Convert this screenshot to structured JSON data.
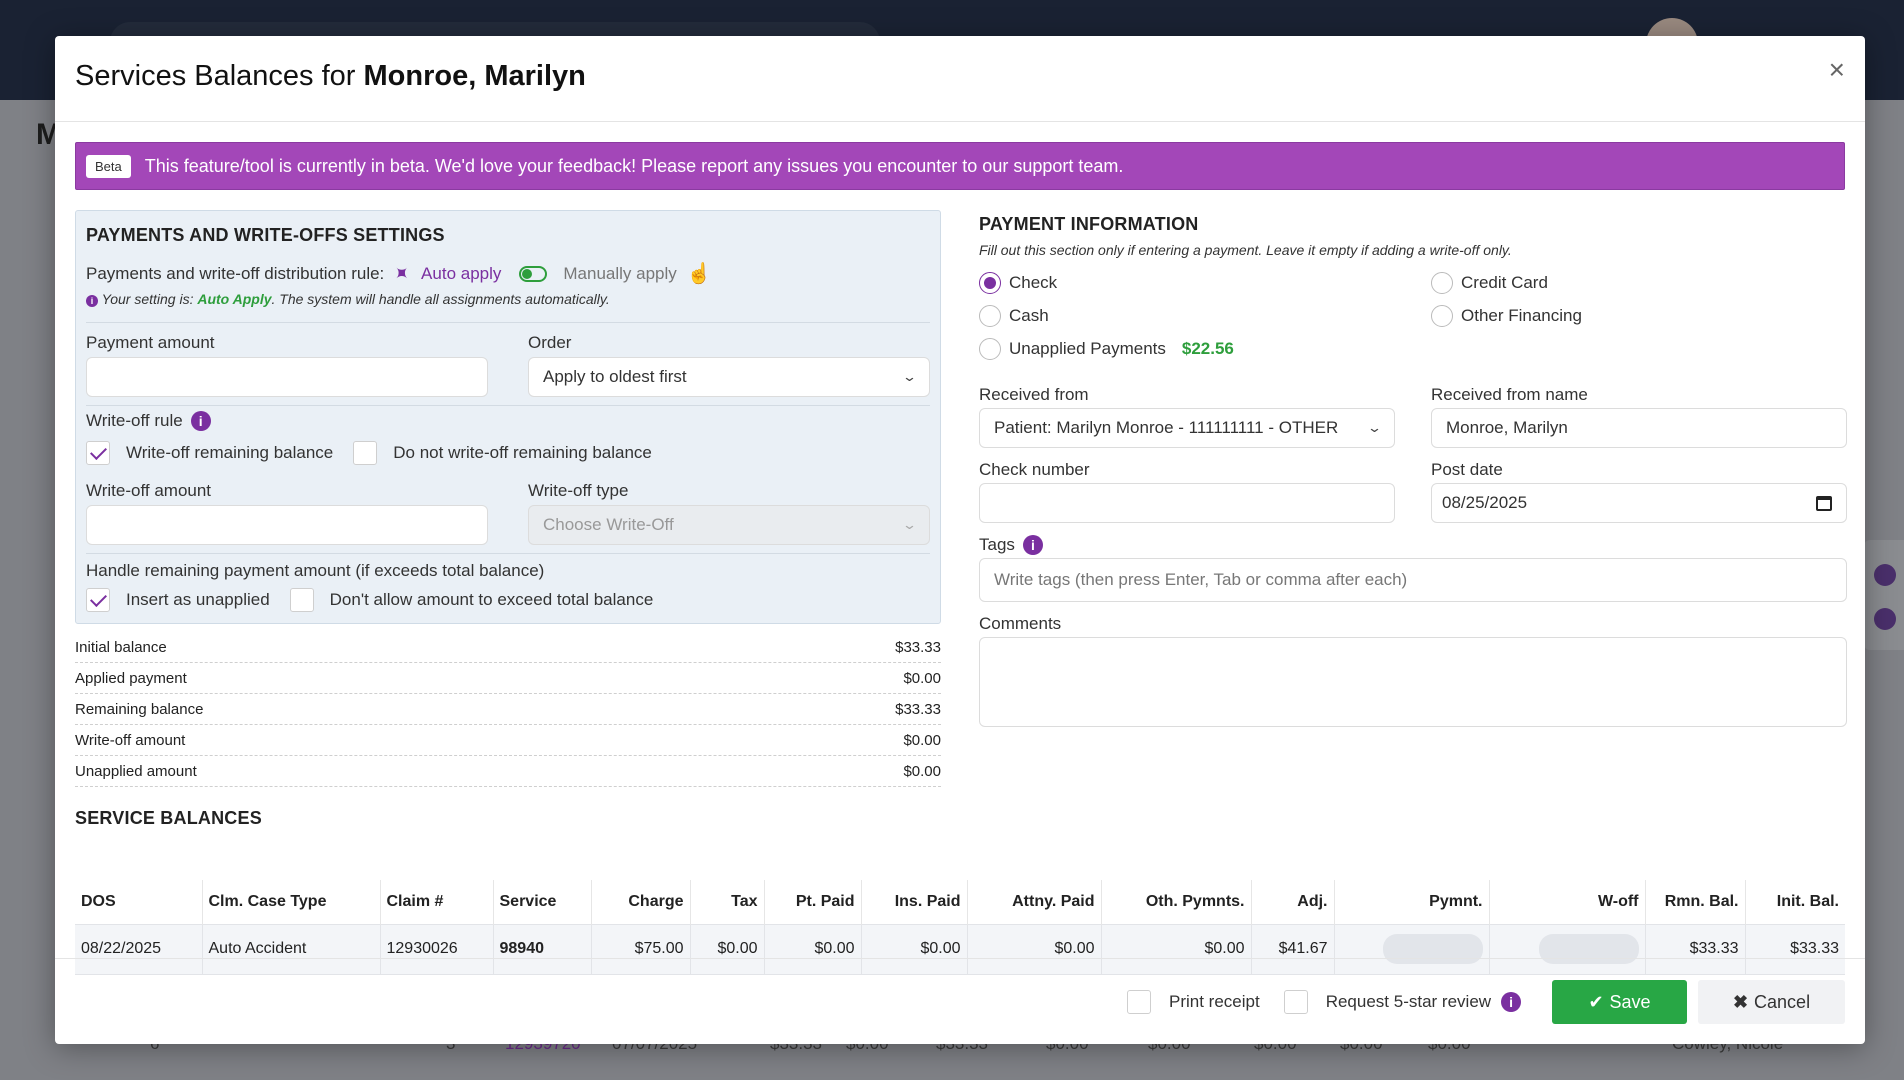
{
  "modal": {
    "title_prefix": "Services Balances for ",
    "patient_name": "Monroe, Marilyn",
    "close_glyph": "×"
  },
  "beta": {
    "badge": "Beta",
    "message": "This feature/tool is currently in beta. We'd love your feedback! Please report any issues you encounter to our support team."
  },
  "settings": {
    "title": "PAYMENTS AND WRITE-OFFS SETTINGS",
    "distribution_label": "Payments and write-off distribution rule:",
    "auto_apply": "Auto apply",
    "manually_apply": "Manually apply",
    "note_prefix": "Your setting is: ",
    "note_value": "Auto Apply",
    "note_suffix": ". The system will handle all assignments automatically.",
    "payment_amount_label": "Payment amount",
    "payment_amount_value": "",
    "order_label": "Order",
    "order_value": "Apply to oldest first",
    "writeoff_rule_label": "Write-off rule",
    "writeoff_remaining": "Write-off remaining balance",
    "no_writeoff_remaining": "Do not write-off remaining balance",
    "writeoff_amount_label": "Write-off amount",
    "writeoff_amount_value": "",
    "writeoff_type_label": "Write-off type",
    "writeoff_type_value": "Choose Write-Off",
    "handle_remaining_label": "Handle remaining payment amount (if exceeds total balance)",
    "insert_unapplied": "Insert as unapplied",
    "dont_exceed": "Don't allow amount to exceed total balance"
  },
  "summary": [
    {
      "label": "Initial balance",
      "value": "$33.33"
    },
    {
      "label": "Applied payment",
      "value": "$0.00"
    },
    {
      "label": "Remaining balance",
      "value": "$33.33"
    },
    {
      "label": "Write-off amount",
      "value": "$0.00"
    },
    {
      "label": "Unapplied amount",
      "value": "$0.00"
    }
  ],
  "payment": {
    "title": "PAYMENT INFORMATION",
    "subtitle": "Fill out this section only if entering a payment. Leave it empty if adding a write-off only.",
    "methods": {
      "check": "Check",
      "cash": "Cash",
      "unapplied": "Unapplied Payments",
      "unapplied_amount": "$22.56",
      "credit_card": "Credit Card",
      "other_financing": "Other Financing"
    },
    "received_from_label": "Received from",
    "received_from_value": "Patient: Marilyn Monroe - 111111111 - OTHER",
    "received_from_name_label": "Received from name",
    "received_from_name_value": "Monroe, Marilyn",
    "check_number_label": "Check number",
    "check_number_value": "",
    "post_date_label": "Post date",
    "post_date_value": "08/25/2025",
    "tags_label": "Tags",
    "tags_placeholder": "Write tags (then press Enter, Tab or comma after each)",
    "comments_label": "Comments",
    "comments_value": ""
  },
  "service_balances": {
    "title": "SERVICE BALANCES",
    "headers": [
      "DOS",
      "Clm. Case Type",
      "Claim #",
      "Service",
      "Charge",
      "Tax",
      "Pt. Paid",
      "Ins. Paid",
      "Attny. Paid",
      "Oth. Pymnts.",
      "Adj.",
      "Pymnt.",
      "W-off",
      "Rmn. Bal.",
      "Init. Bal."
    ],
    "row": {
      "dos": "08/22/2025",
      "case_type": "Auto Accident",
      "claim": "12930026",
      "service": "98940",
      "charge": "$75.00",
      "tax": "$0.00",
      "pt_paid": "$0.00",
      "ins_paid": "$0.00",
      "attny_paid": "$0.00",
      "oth_pymnts": "$0.00",
      "adj": "$41.67",
      "rmn_bal": "$33.33",
      "init_bal": "$33.33"
    }
  },
  "footer": {
    "print_receipt": "Print receipt",
    "request_review": "Request 5-star review",
    "save": "Save",
    "cancel": "Cancel"
  },
  "background": {
    "page_initial": "M",
    "row": {
      "num": "6",
      "count": "3",
      "claim": "12939720",
      "date": "07/07/2025",
      "v1": "$33.33",
      "v2": "$0.00",
      "v3": "$33.33",
      "v4": "$0.00",
      "v5": "$0.00",
      "v6": "$0.00",
      "v7": "$0.00",
      "v8": "$0.00",
      "name": "Cowley, Nicole"
    }
  },
  "colors": {
    "accent": "#7a2fa0",
    "beta_bar": "#a347b8",
    "success": "#28a745",
    "settings_bg": "#eaf0f6"
  }
}
